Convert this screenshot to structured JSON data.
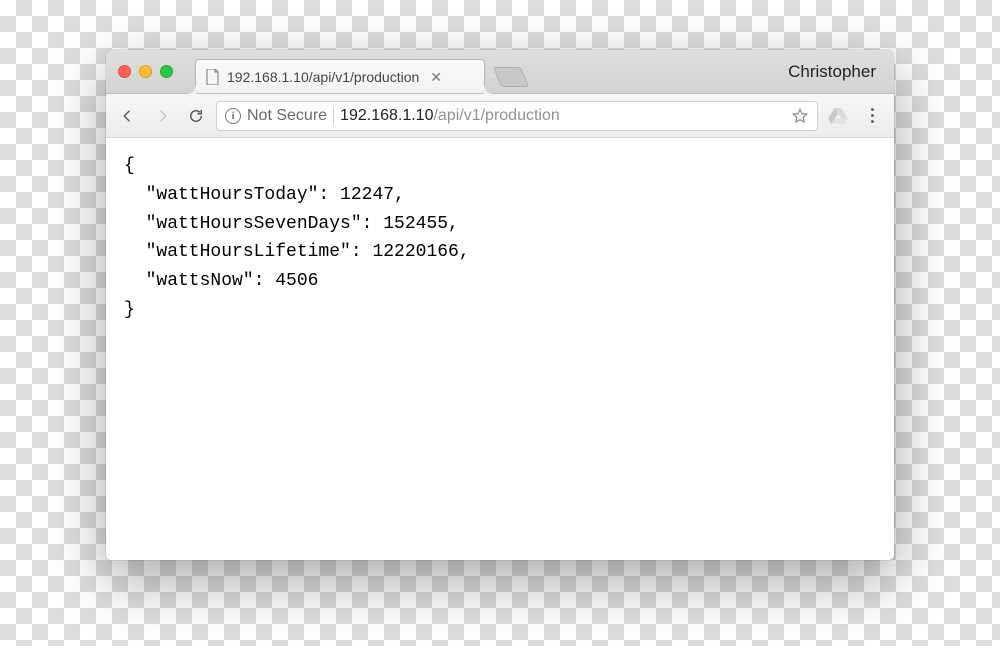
{
  "chrome": {
    "tab_title": "192.168.1.10/api/v1/production",
    "profile_name": "Christopher",
    "security_label": "Not Secure",
    "url_host": "192.168.1.10",
    "url_path": "/api/v1/production"
  },
  "body": {
    "open_brace": "{",
    "close_brace": "}",
    "lines": [
      {
        "key": "wattHoursToday",
        "value": "12247",
        "trailing_comma": true
      },
      {
        "key": "wattHoursSevenDays",
        "value": "152455",
        "trailing_comma": true
      },
      {
        "key": "wattHoursLifetime",
        "value": "12220166",
        "trailing_comma": true
      },
      {
        "key": "wattsNow",
        "value": "4506",
        "trailing_comma": false
      }
    ]
  }
}
